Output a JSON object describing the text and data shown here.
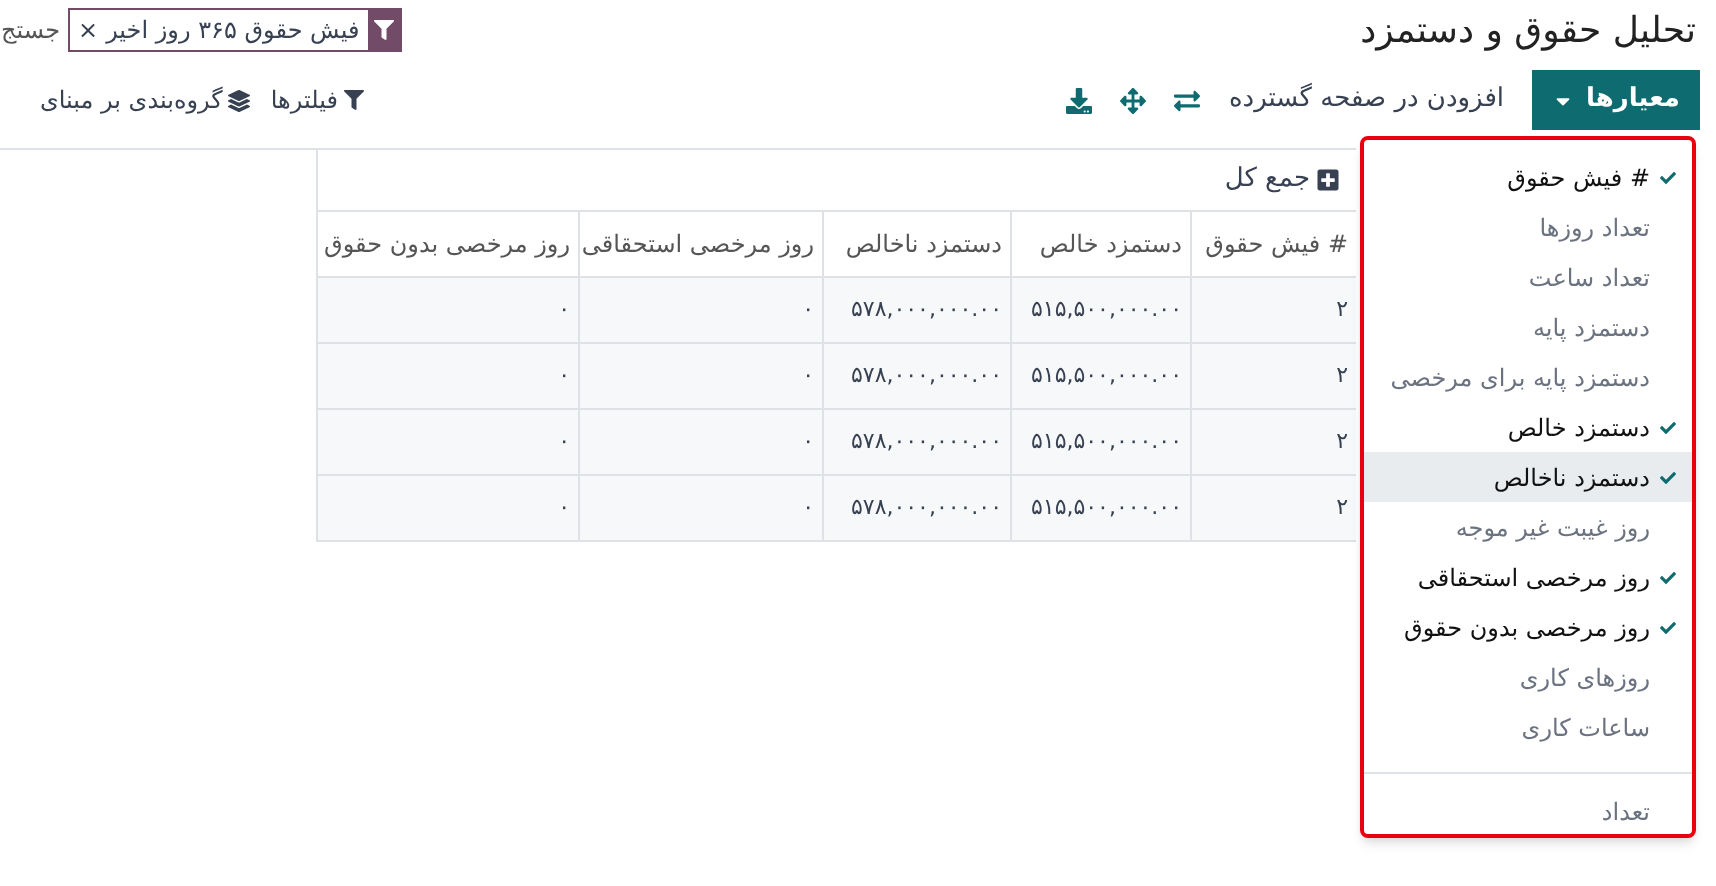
{
  "title": "تحلیل حقوق و دستمزد",
  "search": {
    "facet": "فیش حقوق ۳۶۵ روز اخیر",
    "facet_remove": "×",
    "placeholder": "جستج"
  },
  "toolbar": {
    "measures_button": "معیارها",
    "insert_link": "افزودن در صفحه گسترده",
    "filters": "فیلترها",
    "group_by": "گروه‌بندی بر مبنای"
  },
  "table": {
    "total_header": "جمع کل",
    "columns": [
      "# فیش حقوق",
      "دستمزد خالص",
      "دستمزد ناخالص",
      "روز مرخصی استحقاقی",
      "روز مرخصی بدون حقوق"
    ],
    "rows": [
      [
        "۲",
        "۵۱۵,۵۰۰,۰۰۰.۰۰",
        "۵۷۸,۰۰۰,۰۰۰.۰۰",
        "۰",
        "۰"
      ],
      [
        "۲",
        "۵۱۵,۵۰۰,۰۰۰.۰۰",
        "۵۷۸,۰۰۰,۰۰۰.۰۰",
        "۰",
        "۰"
      ],
      [
        "۲",
        "۵۱۵,۵۰۰,۰۰۰.۰۰",
        "۵۷۸,۰۰۰,۰۰۰.۰۰",
        "۰",
        "۰"
      ],
      [
        "۲",
        "۵۱۵,۵۰۰,۰۰۰.۰۰",
        "۵۷۸,۰۰۰,۰۰۰.۰۰",
        "۰",
        "۰"
      ]
    ]
  },
  "measures_menu": {
    "items": [
      {
        "label": "# فیش حقوق",
        "checked": true,
        "selected": false
      },
      {
        "label": "تعداد روزها",
        "checked": false,
        "selected": false
      },
      {
        "label": "تعداد ساعت",
        "checked": false,
        "selected": false
      },
      {
        "label": "دستمزد پایه",
        "checked": false,
        "selected": false
      },
      {
        "label": "دستمزد پایه برای مرخصی",
        "checked": false,
        "selected": false
      },
      {
        "label": "دستمزد خالص",
        "checked": true,
        "selected": false
      },
      {
        "label": "دستمزد ناخالص",
        "checked": true,
        "selected": true
      },
      {
        "label": "روز غیبت غیر موجه",
        "checked": false,
        "selected": false
      },
      {
        "label": "روز مرخصی استحقاقی",
        "checked": true,
        "selected": false
      },
      {
        "label": "روز مرخصی بدون حقوق",
        "checked": true,
        "selected": false
      },
      {
        "label": "روزهای کاری",
        "checked": false,
        "selected": false
      },
      {
        "label": "ساعات کاری",
        "checked": false,
        "selected": false
      }
    ],
    "count_option": "تعداد"
  }
}
